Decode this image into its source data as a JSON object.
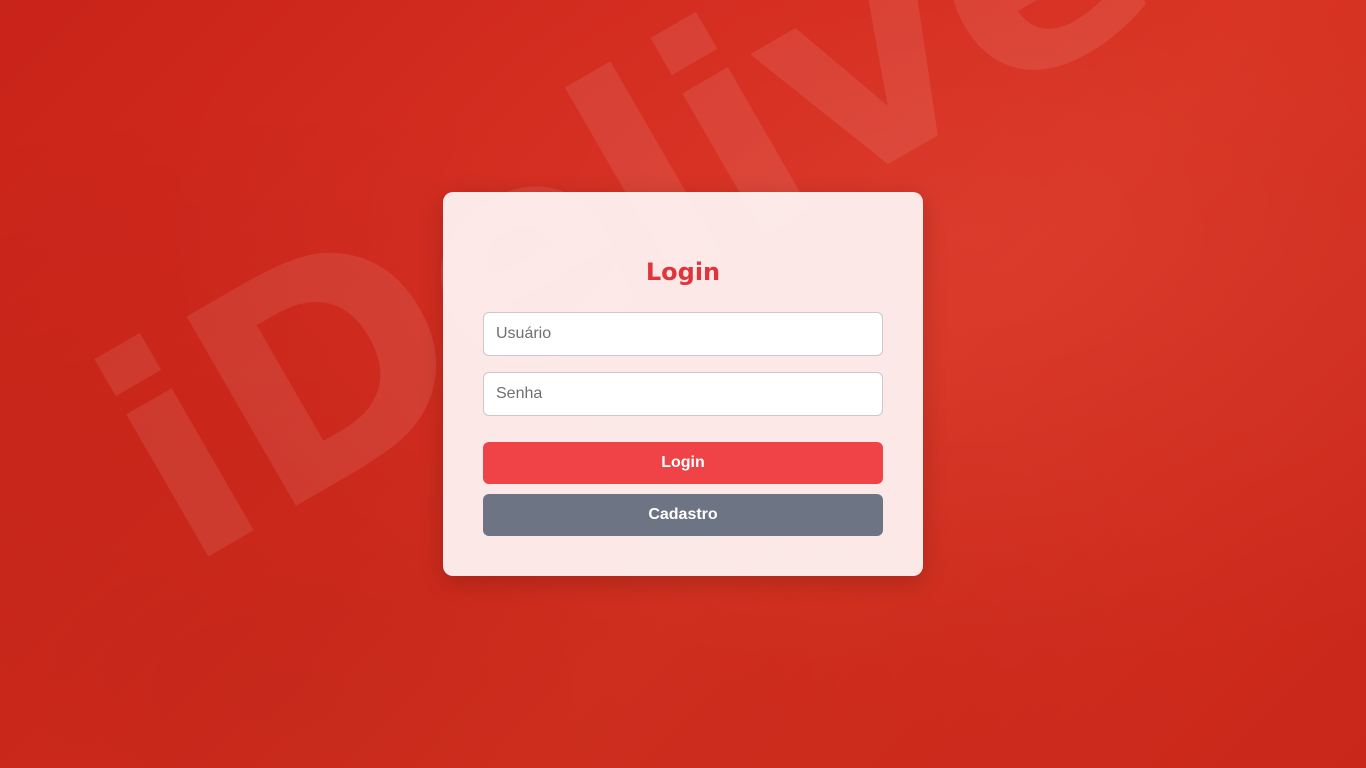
{
  "background": {
    "watermark_text": "iDelivery",
    "gradient_colors": [
      "#c9241a",
      "#d62a1c",
      "#d8301f"
    ]
  },
  "login_form": {
    "title": "Login",
    "username_placeholder": "Usuário",
    "password_placeholder": "Senha",
    "login_button_label": "Login",
    "signup_button_label": "Cadastro"
  },
  "colors": {
    "accent": "#ef4347",
    "title": "#e0363b",
    "secondary_button": "#6d7585",
    "card_background": "#fdf0ef"
  }
}
